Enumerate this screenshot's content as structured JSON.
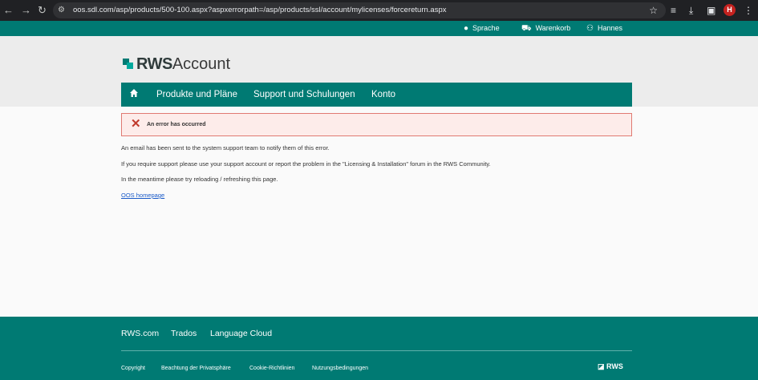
{
  "browser": {
    "url": "oos.sdl.com/asp/products/500-100.aspx?aspxerrorpath=/asp/products/ssl/account/mylicenses/forcereturn.aspx",
    "avatar_letter": "H"
  },
  "topbar": {
    "language": "Sprache",
    "cart": "Warenkorb",
    "user": "Hannes"
  },
  "logo": {
    "bold": "RWS",
    "light": "Account"
  },
  "nav": {
    "items": [
      "Produkte und Pläne",
      "Support und Schulungen",
      "Konto"
    ]
  },
  "alert": {
    "message": "An error has occurred"
  },
  "content": {
    "line1": "An email has been sent to the system support team to notify them of this error.",
    "line2": "If you require support please use your support account or report the problem in the \"Licensing & Installation\" forum in the RWS Community.",
    "line3": "In the meantime please try reloading / refreshing this page.",
    "home_link": "OOS homepage"
  },
  "footer": {
    "links": [
      "RWS.com",
      "Trados",
      "Language Cloud"
    ],
    "small_links": [
      "Copyright",
      "Beachtung der Privatsphäre",
      "Cookie-Richtlinien",
      "Nutzungsbedingungen"
    ],
    "brand": "RWS"
  },
  "colors": {
    "brand": "#007a73",
    "alert_bg": "#fdecea",
    "alert_border": "#e07a72",
    "error_icon": "#c0392b"
  }
}
